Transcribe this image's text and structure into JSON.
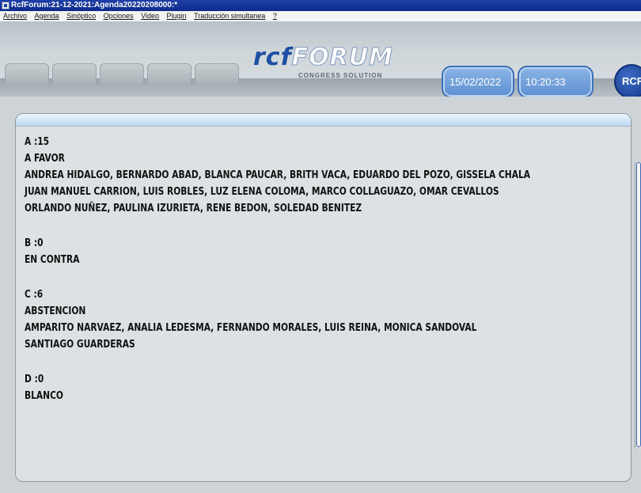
{
  "window": {
    "title": "RcfForum:21-12-2021:Agenda20220208000:*"
  },
  "menu": [
    "Archivo",
    "Agenda",
    "Sinóptico",
    "Opciones",
    "Video",
    "Plugin",
    "Traducción simultanea",
    "?"
  ],
  "header": {
    "logo_main_a": "rcf",
    "logo_main_b": "FORUM",
    "logo_sub": "CONGRESS SOLUTION",
    "date": "15/02/2022",
    "time": "10:20:33",
    "badge": "RCF"
  },
  "results": [
    {
      "code": "A :15",
      "label": "A FAVOR",
      "names": [
        "ANDREA HIDALGO, BERNARDO ABAD, BLANCA PAUCAR, BRITH VACA, EDUARDO DEL POZO, GISSELA CHALA",
        "JUAN MANUEL CARRION, LUIS ROBLES, LUZ ELENA COLOMA, MARCO COLLAGUAZO, OMAR CEVALLOS",
        "ORLANDO NUÑEZ, PAULINA IZURIETA, RENE BEDON, SOLEDAD BENITEZ"
      ]
    },
    {
      "code": "B :0",
      "label": "EN CONTRA",
      "names": []
    },
    {
      "code": "C :6",
      "label": "ABSTENCION",
      "names": [
        "AMPARITO NARVAEZ, ANALIA LEDESMA, FERNANDO MORALES, LUIS REINA, MONICA SANDOVAL",
        "SANTIAGO GUARDERAS"
      ]
    },
    {
      "code": "D :0",
      "label": "BLANCO",
      "names": []
    }
  ],
  "colors": {
    "accent": "#1e4fa3",
    "pill": "#5e8fd2",
    "titlebar": "#0b2a8c"
  }
}
